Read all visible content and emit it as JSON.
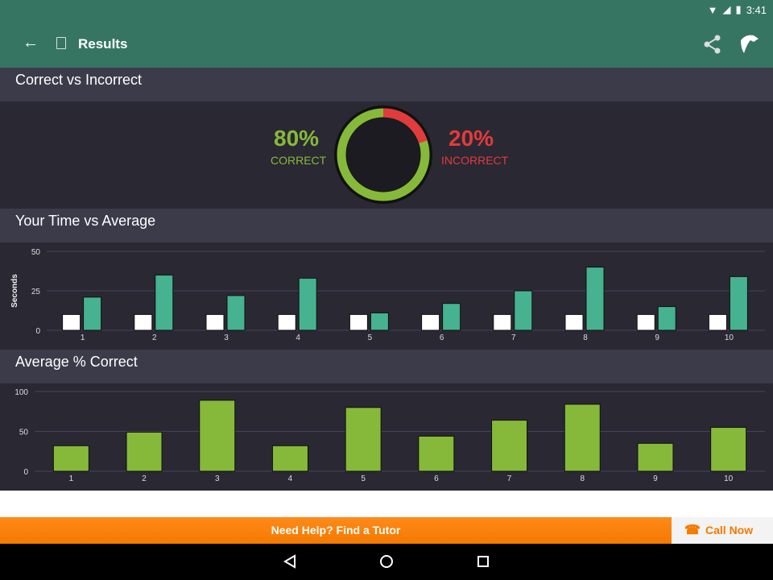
{
  "status": {
    "time": "3:41"
  },
  "appbar": {
    "title": "Results"
  },
  "sections": {
    "correct": "Correct vs Incorrect",
    "time": "Your Time vs Average",
    "avg": "Average % Correct"
  },
  "summary": {
    "correct_pct": "80%",
    "correct_label": "CORRECT",
    "incorrect_pct": "20%",
    "incorrect_label": "INCORRECT",
    "correct_fraction": 0.8
  },
  "colors": {
    "correct": "#86b93a",
    "incorrect": "#e23b3b",
    "average": "#46b28f",
    "yours": "#ffffff"
  },
  "chart_data": [
    {
      "type": "bar",
      "title": "Your Time vs Average",
      "ylabel": "Seconds",
      "ylim": [
        0,
        50
      ],
      "yticks": [
        "0",
        "25",
        "50"
      ],
      "categories": [
        "1",
        "2",
        "3",
        "4",
        "5",
        "6",
        "7",
        "8",
        "9",
        "10"
      ],
      "series": [
        {
          "name": "Your Time",
          "values": [
            10,
            10,
            10,
            10,
            10,
            10,
            10,
            10,
            10,
            10
          ]
        },
        {
          "name": "Average",
          "values": [
            21,
            35,
            22,
            33,
            11,
            17,
            25,
            40,
            15,
            34
          ]
        }
      ]
    },
    {
      "type": "bar",
      "title": "Average % Correct",
      "ylim": [
        0,
        100
      ],
      "yticks": [
        "0",
        "50",
        "100"
      ],
      "categories": [
        "1",
        "2",
        "3",
        "4",
        "5",
        "6",
        "7",
        "8",
        "9",
        "10"
      ],
      "values": [
        32,
        49,
        89,
        32,
        80,
        44,
        64,
        84,
        35,
        55
      ]
    }
  ],
  "banner": {
    "text": "Need Help? Find a Tutor",
    "call": "Call Now"
  }
}
